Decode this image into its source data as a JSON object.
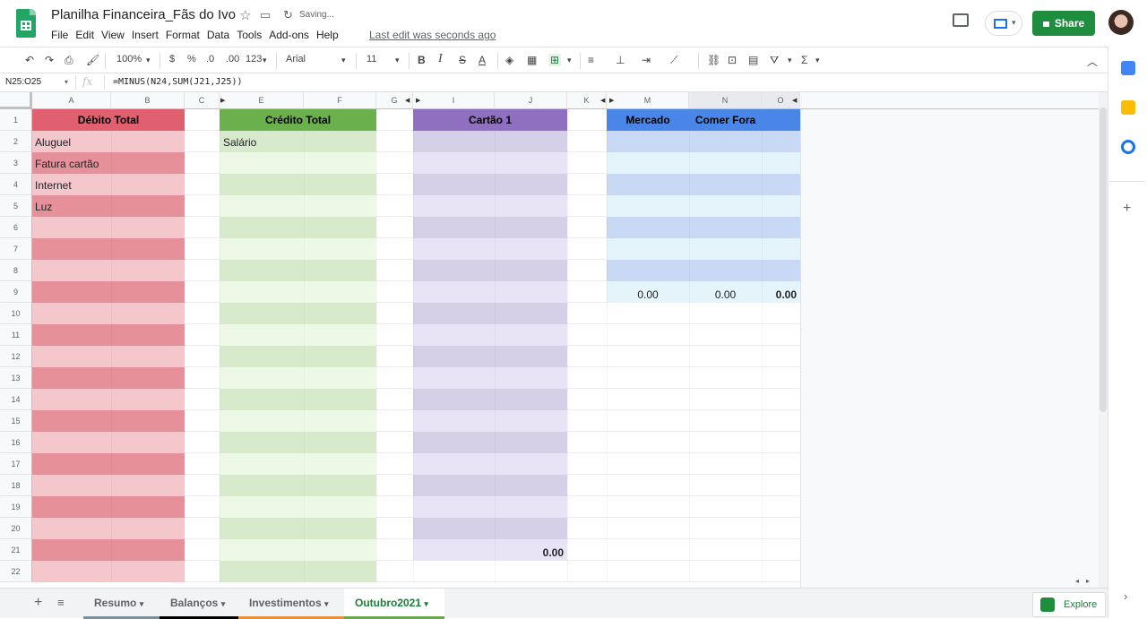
{
  "app": {
    "title": "Planilha Financeira_Fãs do Ivo",
    "status": "Saving...",
    "last_edit": "Last edit was seconds ago",
    "share_label": "Share"
  },
  "menu": [
    "File",
    "Edit",
    "View",
    "Insert",
    "Format",
    "Data",
    "Tools",
    "Add-ons",
    "Help"
  ],
  "toolbar": {
    "zoom": "100%",
    "currency": "$",
    "percent": "%",
    "dec_less": ".0",
    "dec_more": ".00",
    "format_more": "123",
    "font": "Arial",
    "font_size": "11",
    "bold": "B",
    "italic": "I",
    "strike": "S",
    "text_color": "A",
    "functions": "Σ"
  },
  "formula_bar": {
    "name_box": "N25:O25",
    "fx": "fx",
    "formula": "=MINUS(N24,SUM(J21,J25))"
  },
  "columns": [
    "A",
    "B",
    "C",
    "E",
    "F",
    "G",
    "I",
    "J",
    "K",
    "M",
    "N",
    "O"
  ],
  "rows": [
    "1",
    "2",
    "3",
    "4",
    "5",
    "6",
    "7",
    "8",
    "9",
    "10",
    "11",
    "12",
    "13",
    "14",
    "15",
    "16",
    "17",
    "18",
    "19",
    "20",
    "21",
    "22"
  ],
  "sections": {
    "debito": {
      "header": "Débito Total",
      "items": [
        "Aluguel",
        "Fatura cartão",
        "Internet",
        "Luz"
      ]
    },
    "credito": {
      "header": "Crédito Total",
      "items": [
        "Salário"
      ]
    },
    "cartao": {
      "header": "Cartão 1",
      "total": "0.00"
    },
    "categorias": {
      "header_mercado": "Mercado",
      "header_comer": "Comer Fora",
      "totals": [
        "0.00",
        "0.00",
        "0.00"
      ]
    }
  },
  "colors": {
    "debito_header": "#e06070",
    "debito_light": "#f4c7cc",
    "debito_dark": "#e6909a",
    "credito_header": "#6ab04c",
    "credito_light": "#eef8e6",
    "credito_dark": "#d7ebcc",
    "cartao_header": "#8e6fc0",
    "cartao_light": "#e8e4f6",
    "cartao_dark": "#d6cfe8",
    "cat_header": "#4a86e8",
    "cat_light": "#e4f4fa",
    "cat_dark": "#c7d9f5"
  },
  "tabs": [
    {
      "label": "Resumo",
      "color": "#7c8f9a"
    },
    {
      "label": "Balanços",
      "color": "#000000"
    },
    {
      "label": "Investimentos",
      "color": "#e69138"
    },
    {
      "label": "Outubro2021",
      "color": "#6aa84f"
    }
  ],
  "explore_label": "Explore"
}
